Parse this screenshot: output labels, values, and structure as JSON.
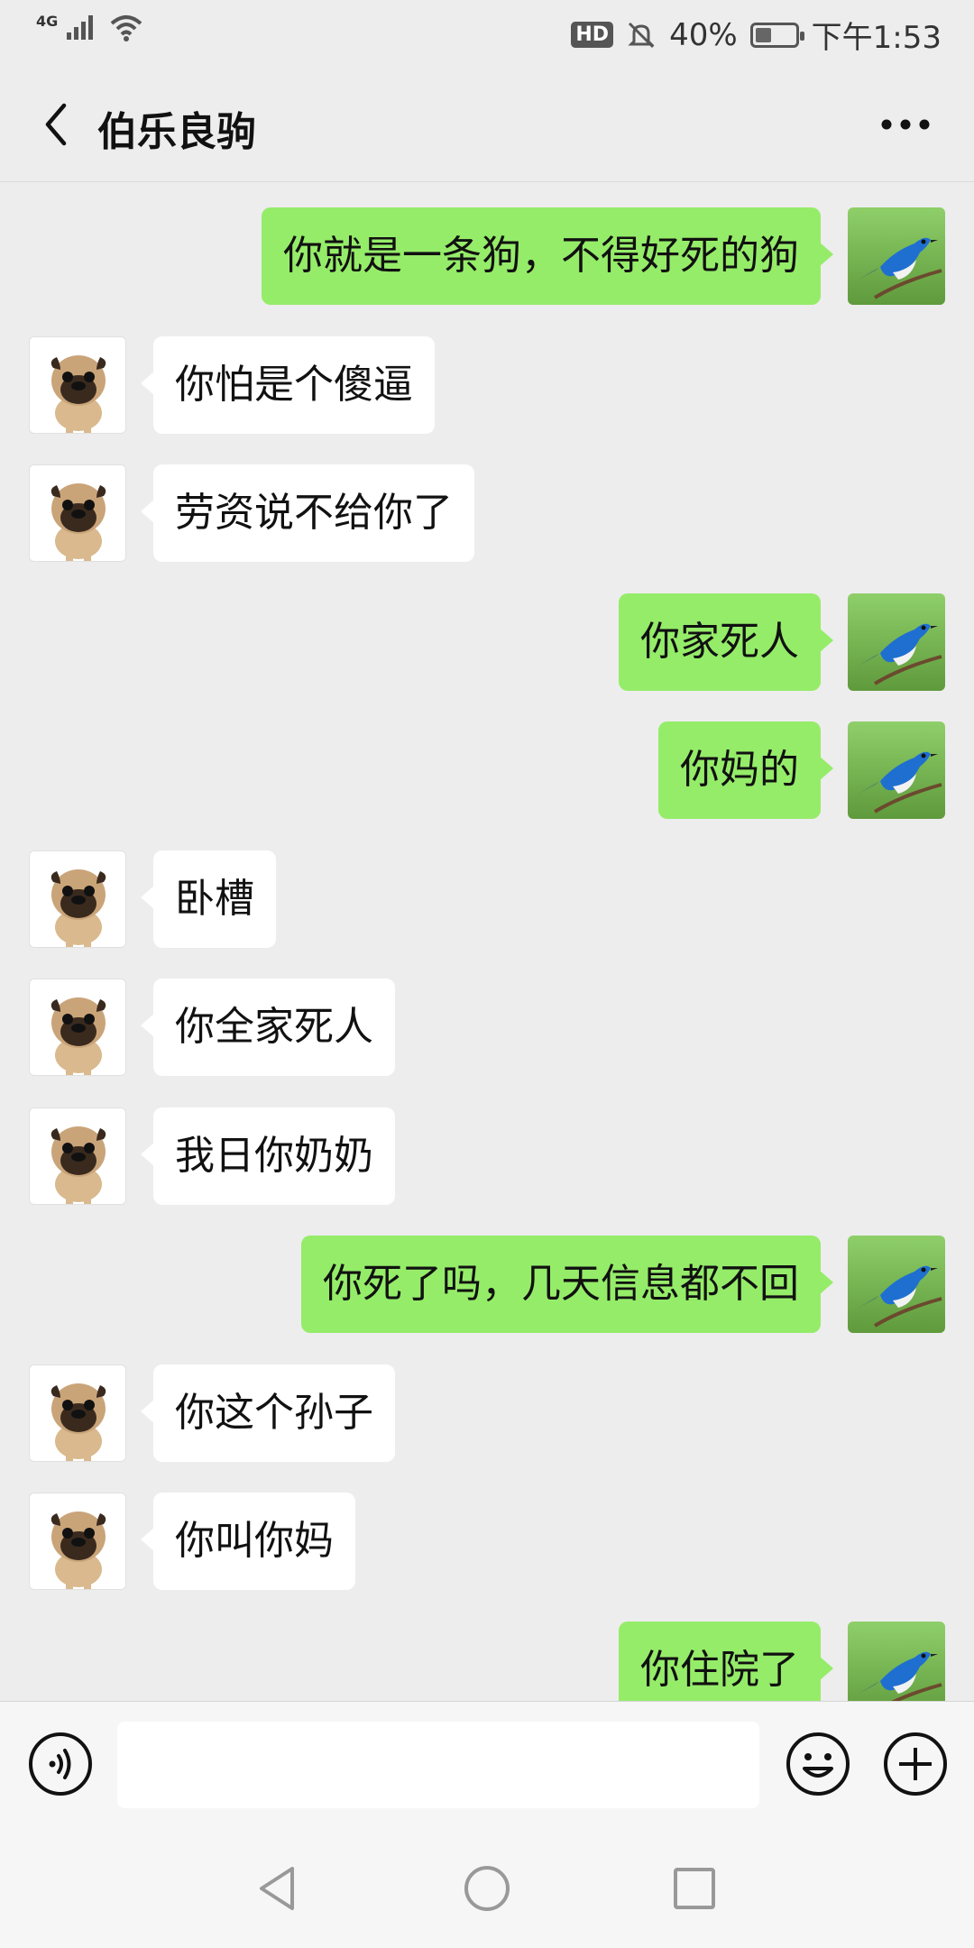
{
  "status_bar": {
    "network": "4G",
    "hd": "HD",
    "battery_percent": "40%",
    "battery_level": 0.4,
    "time": "下午1:53"
  },
  "header": {
    "title": "伯乐良驹",
    "back_icon": "chevron-left-icon",
    "more_icon": "more-dots-icon"
  },
  "messages": [
    {
      "side": "out",
      "text": "你就是一条狗，不得好死的狗"
    },
    {
      "side": "in",
      "text": "你怕是个傻逼"
    },
    {
      "side": "in",
      "text": "劳资说不给你了"
    },
    {
      "side": "out",
      "text": "你家死人"
    },
    {
      "side": "out",
      "text": "你妈的"
    },
    {
      "side": "in",
      "text": "卧槽"
    },
    {
      "side": "in",
      "text": "你全家死人"
    },
    {
      "side": "in",
      "text": "我日你奶奶"
    },
    {
      "side": "out",
      "text": "你死了吗，几天信息都不回"
    },
    {
      "side": "in",
      "text": "你这个孙子"
    },
    {
      "side": "in",
      "text": "你叫你妈"
    },
    {
      "side": "out",
      "text": "你住院了"
    }
  ],
  "input_bar": {
    "text_value": "",
    "voice_icon": "voice-icon",
    "emoji_icon": "emoji-icon",
    "plus_icon": "plus-circle-icon"
  },
  "system_nav": {
    "back_icon": "triangle-back-icon",
    "home_icon": "circle-home-icon",
    "recent_icon": "square-recent-icon"
  },
  "colors": {
    "background": "#ededed",
    "outgoing_bubble": "#95ec69",
    "incoming_bubble": "#ffffff"
  }
}
